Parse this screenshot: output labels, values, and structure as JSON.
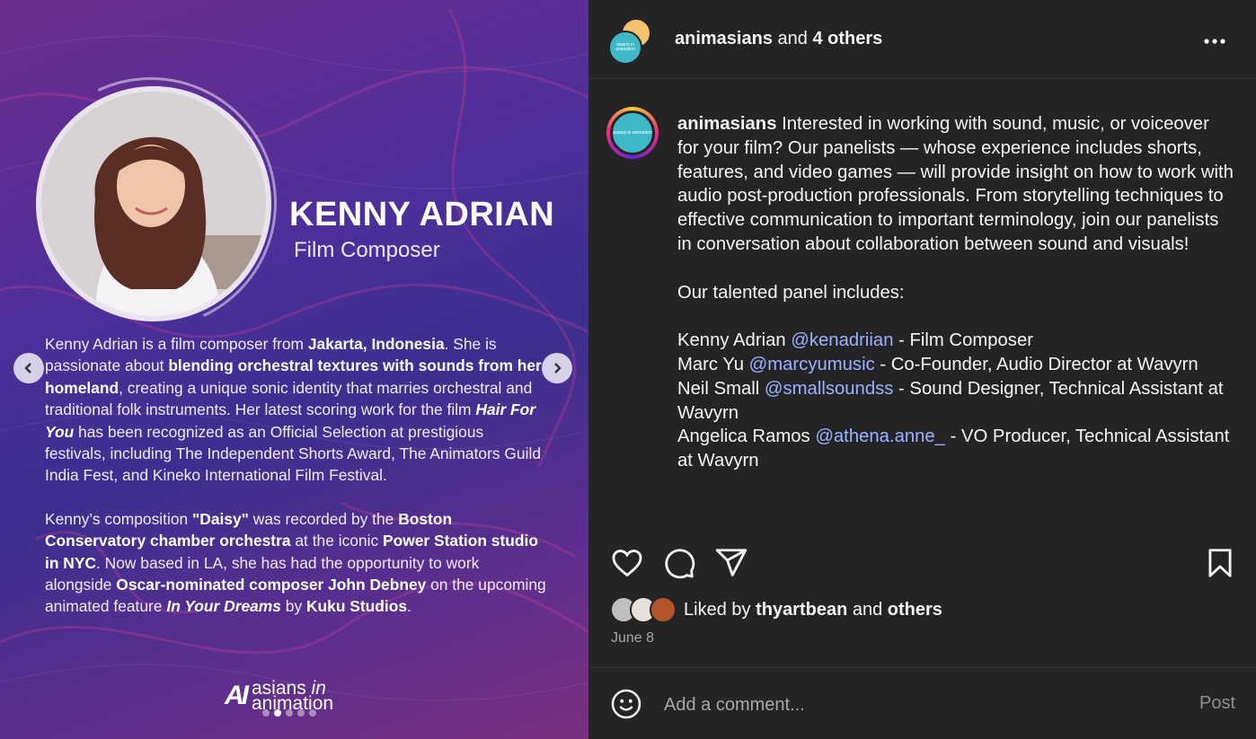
{
  "slide": {
    "name": "KENNY ADRIAN",
    "role": "Film Composer",
    "bio_p1": [
      {
        "t": "Kenny Adrian is a film composer from ",
        "b": false
      },
      {
        "t": "Jakarta, Indonesia",
        "b": true
      },
      {
        "t": ". She is passionate about ",
        "b": false
      },
      {
        "t": "blending orchestral textures with sounds from her homeland",
        "b": true
      },
      {
        "t": ", creating a unique sonic identity that marries orchestral and traditional folk instruments. Her latest scoring work for the film ",
        "b": false
      },
      {
        "t": "Hair For You",
        "b": true,
        "i": true
      },
      {
        "t": " has been recognized as an Official Selection at prestigious festivals, including The Independent Shorts Award, The Animators Guild India Fest, and Kineko International Film Festival.",
        "b": false
      }
    ],
    "bio_p2": [
      {
        "t": "Kenny’s composition ",
        "b": false
      },
      {
        "t": "\"Daisy\"",
        "b": true
      },
      {
        "t": " was recorded by the ",
        "b": false
      },
      {
        "t": "Boston Conservatory chamber orchestra",
        "b": true
      },
      {
        "t": " at the iconic ",
        "b": false
      },
      {
        "t": "Power Station studio in NYC",
        "b": true
      },
      {
        "t": ". Now based in LA, she has had the opportunity to work alongside ",
        "b": false
      },
      {
        "t": "Oscar-nominated composer John Debney",
        "b": true
      },
      {
        "t": " on the upcoming animated feature ",
        "b": false
      },
      {
        "t": "In Your Dreams",
        "b": true,
        "i": true
      },
      {
        "t": " by ",
        "b": false
      },
      {
        "t": "Kuku Studios",
        "b": true
      },
      {
        "t": ".",
        "b": false
      }
    ],
    "logo_mark": "AI",
    "logo_line1": "asians ",
    "logo_line1_italic": "in",
    "logo_line2": "animation",
    "carousel_total": 5,
    "carousel_active": 2,
    "prev_icon": "chevron-left-icon",
    "next_icon": "chevron-right-icon"
  },
  "header": {
    "username": "animasians",
    "and_text": " and ",
    "others": "4 others",
    "avatar_text": "asians in animation",
    "more_icon": "more-horizontal-icon"
  },
  "caption": {
    "username": "animasians",
    "intro": " Interested in working with sound, music, or voiceover for your film? Our panelists — whose experience includes shorts, features, and video games — will provide insight on how to work with audio post-production professionals. From storytelling techniques to effective communication to important terminology, join our panelists in conversation about collaboration between sound and visuals!",
    "panel_heading": "Our talented panel includes:",
    "panelists": [
      {
        "name": "Kenny Adrian ",
        "handle": "@kenadriian",
        "role": " - Film Composer"
      },
      {
        "name": "Marc Yu ",
        "handle": "@marcyumusic",
        "role": " - Co-Founder, Audio Director at Wavyrn"
      },
      {
        "name": "Neil Small ",
        "handle": "@smallsoundss",
        "role": " - Sound Designer, Technical Assistant at Wavyrn"
      },
      {
        "name": "Angelica Ramos ",
        "handle": "@athena.anne_",
        "role": " - VO Producer, Technical Assistant at Wavyrn"
      }
    ]
  },
  "actions": {
    "like_icon": "heart-icon",
    "comment_icon": "comment-icon",
    "share_icon": "share-icon",
    "save_icon": "bookmark-icon"
  },
  "likes": {
    "prefix": "Liked by ",
    "user": "thyartbean",
    "middle": " and ",
    "others": "others"
  },
  "date": "June 8",
  "comment": {
    "placeholder": "Add a comment...",
    "post_label": "Post",
    "emoji_icon": "emoji-icon"
  },
  "colors": {
    "panel_bg": "#242426",
    "mention": "#9bb3ff",
    "brand_teal": "#3fb8c8"
  }
}
